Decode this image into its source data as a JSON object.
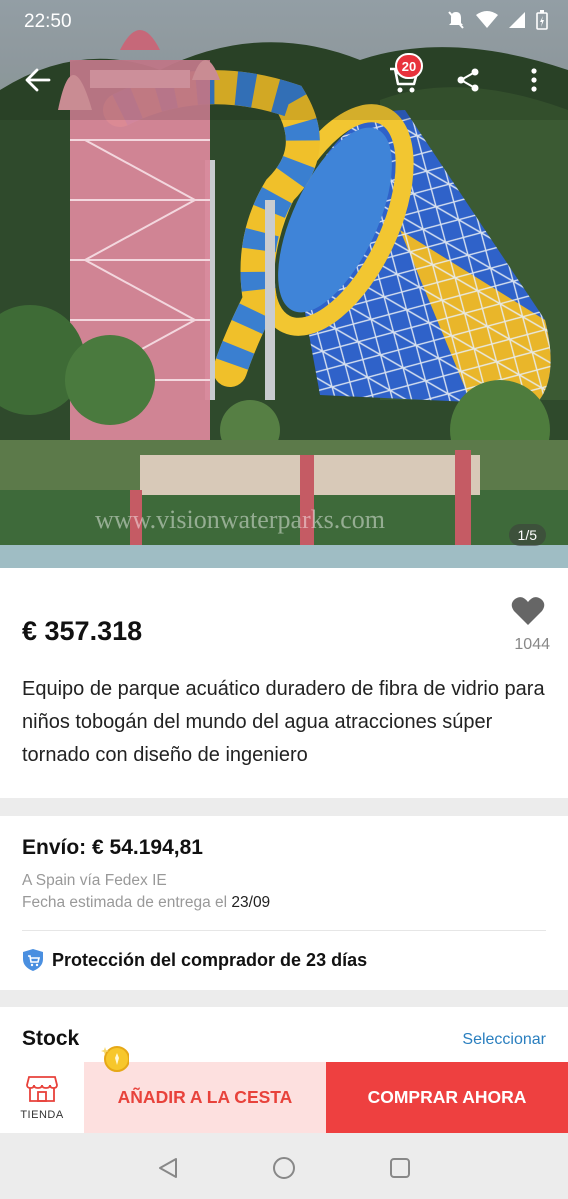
{
  "status": {
    "time": "22:50"
  },
  "header": {
    "cart_count": "20"
  },
  "gallery": {
    "counter": "1/5",
    "watermark": "www.visionwaterparks.com"
  },
  "product": {
    "price": "€ 357.318",
    "favorites": "1044",
    "title": "Equipo de parque acuático duradero de fibra de vidrio para niños tobogán del mundo del agua atracciones súper tornado con diseño de ingeniero"
  },
  "shipping": {
    "title": "Envío: € 54.194,81",
    "route": "A Spain vía Fedex IE",
    "delivery_label": "Fecha estimada de entrega el",
    "delivery_date": "23/09",
    "protection": "Protección del comprador de 23 días"
  },
  "stock": {
    "label": "Stock",
    "action": "Seleccionar"
  },
  "bottom": {
    "store": "TIENDA",
    "add_to_cart": "AÑADIR A LA CESTA",
    "buy_now": "COMPRAR AHORA"
  },
  "colors": {
    "accent": "#ee4040",
    "add_bg": "#fde0df",
    "link": "#2a7fbf",
    "badge": "#e8323c"
  },
  "icons": [
    "back-arrow-icon",
    "cart-icon",
    "share-icon",
    "more-vertical-icon",
    "heart-icon",
    "shield-icon",
    "store-icon",
    "coin-icon",
    "nav-back-icon",
    "nav-home-icon",
    "nav-recents-icon"
  ]
}
